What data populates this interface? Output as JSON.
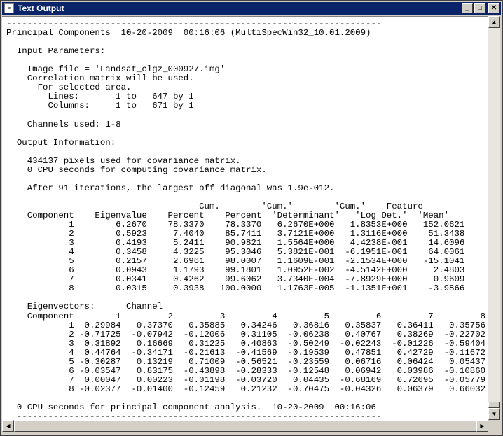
{
  "window": {
    "title": "Text Output",
    "app_icon": "document-icon",
    "controls": {
      "minimize": "_",
      "maximize": "□",
      "close": "✕"
    }
  },
  "output_lines": [
    "------------------------------------------------------------------------",
    "Principal Components  10-20-2009  00:16:06 (MultiSpecWin32_10.01.2009)",
    "",
    "  Input Parameters:",
    "",
    "    Image file = 'Landsat_clgz_000927.img'",
    "    Correlation matrix will be used.",
    "      For selected area.",
    "        Lines:       1 to   647 by 1",
    "        Columns:     1 to   671 by 1",
    "",
    "    Channels used: 1-8",
    "",
    "  Output Information:",
    "",
    "    434137 pixels used for covariance matrix.",
    "    0 CPU seconds for computing covariance matrix.",
    "",
    "    After 91 iterations, the largest off diagonal was 1.9e-012.",
    "",
    "                                     Cum.        'Cum.'        'Cum.'    Feature",
    "    Component    Eigenvalue    Percent    Percent  'Determinant'   'Log Det.'  'Mean'",
    "            1        6.2670    78.3370    78.3370   6.2670E+000   1.8353E+000   152.0621",
    "            2        0.5923     7.4040    85.7411   3.7121E+000   1.3116E+000    51.3438",
    "            3        0.4193     5.2411    90.9821   1.5564E+000   4.4238E-001    14.6096",
    "            4        0.3458     4.3225    95.3046   5.3821E-001  -6.1951E-001    64.0061",
    "            5        0.2157     2.6961    98.0007   1.1609E-001  -2.1534E+000   -15.1041",
    "            6        0.0943     1.1793    99.1801   1.0952E-002  -4.5142E+000     2.4803",
    "            7        0.0341     0.4262    99.6062   3.7340E-004  -7.8929E+000     0.9609",
    "            8        0.0315     0.3938   100.0000   1.1763E-005  -1.1351E+001    -3.9866",
    "",
    "    Eigenvectors:      Channel",
    "    Component        1         2         3         4         5         6         7         8",
    "            1  0.29984   0.37370   0.35885   0.34246   0.36816   0.35837   0.36411   0.35756",
    "            2 -0.71725  -0.07942  -0.12006   0.31105  -0.06238   0.40767   0.38269  -0.22702",
    "            3  0.31892   0.16669   0.31225   0.40863  -0.50249  -0.02243  -0.01226  -0.59404",
    "            4  0.44764  -0.34171  -0.21613  -0.41569  -0.19539   0.47851   0.42729  -0.11672",
    "            5 -0.30287   0.13219   0.71009  -0.56521  -0.23559   0.06716   0.06424   0.05437",
    "            6 -0.03547   0.83175  -0.43898  -0.28333  -0.12548   0.06942   0.03986  -0.10860",
    "            7  0.00047   0.00223  -0.01198  -0.03720   0.04435  -0.68169   0.72695  -0.05779",
    "            8 -0.02377  -0.01400  -0.12459   0.21232  -0.70475  -0.04326   0.06379   0.66032",
    "",
    "  0 CPU seconds for principal component analysis.  10-20-2009  00:16:06",
    "  ----------------------------------------------------------------------"
  ]
}
